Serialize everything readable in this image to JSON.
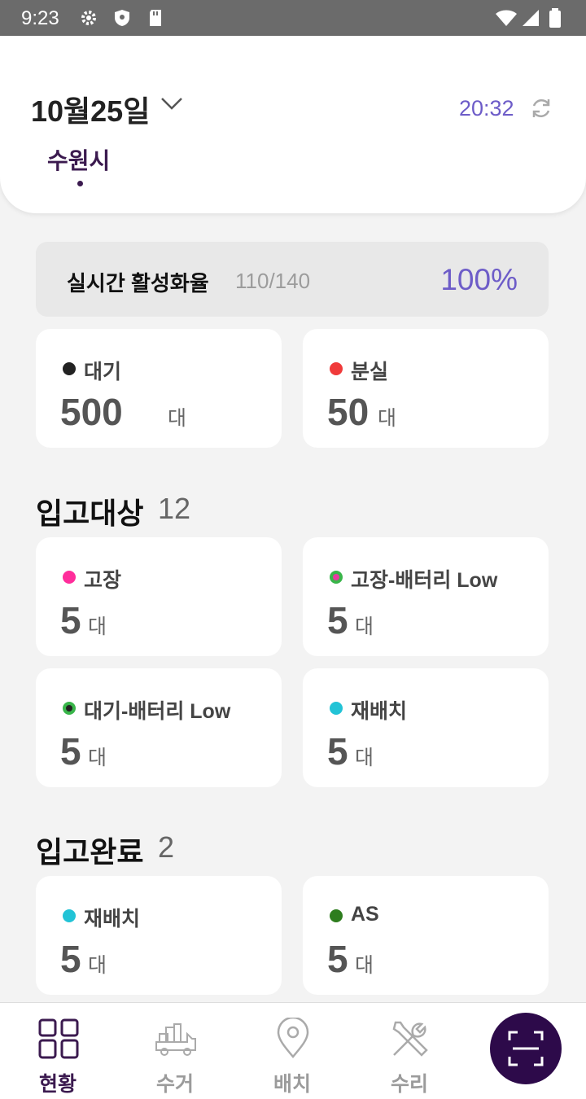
{
  "status_bar": {
    "time": "9:23",
    "icons": [
      "gear-icon",
      "shield-icon",
      "sd-card-icon",
      "wifi-icon",
      "signal-icon",
      "battery-icon"
    ]
  },
  "header": {
    "date": "10월25일",
    "time": "20:32",
    "city_tab": "수원시"
  },
  "activation": {
    "label": "실시간 활성화율",
    "count": "110/140",
    "percent": "100%"
  },
  "overview_cards": [
    {
      "label": "대기",
      "value": "500",
      "unit": "대",
      "dot_color": "#222222"
    },
    {
      "label": "분실",
      "value": "50",
      "unit": "대",
      "dot_color": "#f03a3a"
    }
  ],
  "incoming": {
    "title": "입고대상",
    "count": "12",
    "cards": [
      {
        "label": "고장",
        "value": "5",
        "unit": "대",
        "dot_color": "#ff2d9b"
      },
      {
        "label": "고장-배터리 Low",
        "value": "5",
        "unit": "대",
        "dot_color": "#e83aa0",
        "ring_color": "#39b54a"
      },
      {
        "label": "대기-배터리 Low",
        "value": "5",
        "unit": "대",
        "dot_color": "#222222",
        "ring_color": "#39b54a"
      },
      {
        "label": "재배치",
        "value": "5",
        "unit": "대",
        "dot_color": "#22c3d6"
      }
    ]
  },
  "completed": {
    "title": "입고완료",
    "count": "2",
    "cards": [
      {
        "label": "재배치",
        "value": "5",
        "unit": "대",
        "dot_color": "#22c3d6"
      },
      {
        "label": "AS",
        "value": "5",
        "unit": "대",
        "dot_color": "#2e7d1e"
      }
    ]
  },
  "bottom_nav": [
    {
      "label": "현황",
      "icon": "dashboard-icon",
      "active": true
    },
    {
      "label": "수거",
      "icon": "truck-icon",
      "active": false
    },
    {
      "label": "배치",
      "icon": "location-pin-icon",
      "active": false
    },
    {
      "label": "수리",
      "icon": "tools-icon",
      "active": false
    }
  ],
  "scan_button": {
    "icon": "scan-icon"
  },
  "colors": {
    "accent": "#6d5cc8",
    "primary_dark": "#2d0a4a",
    "brand_text": "#3b1a4f"
  }
}
